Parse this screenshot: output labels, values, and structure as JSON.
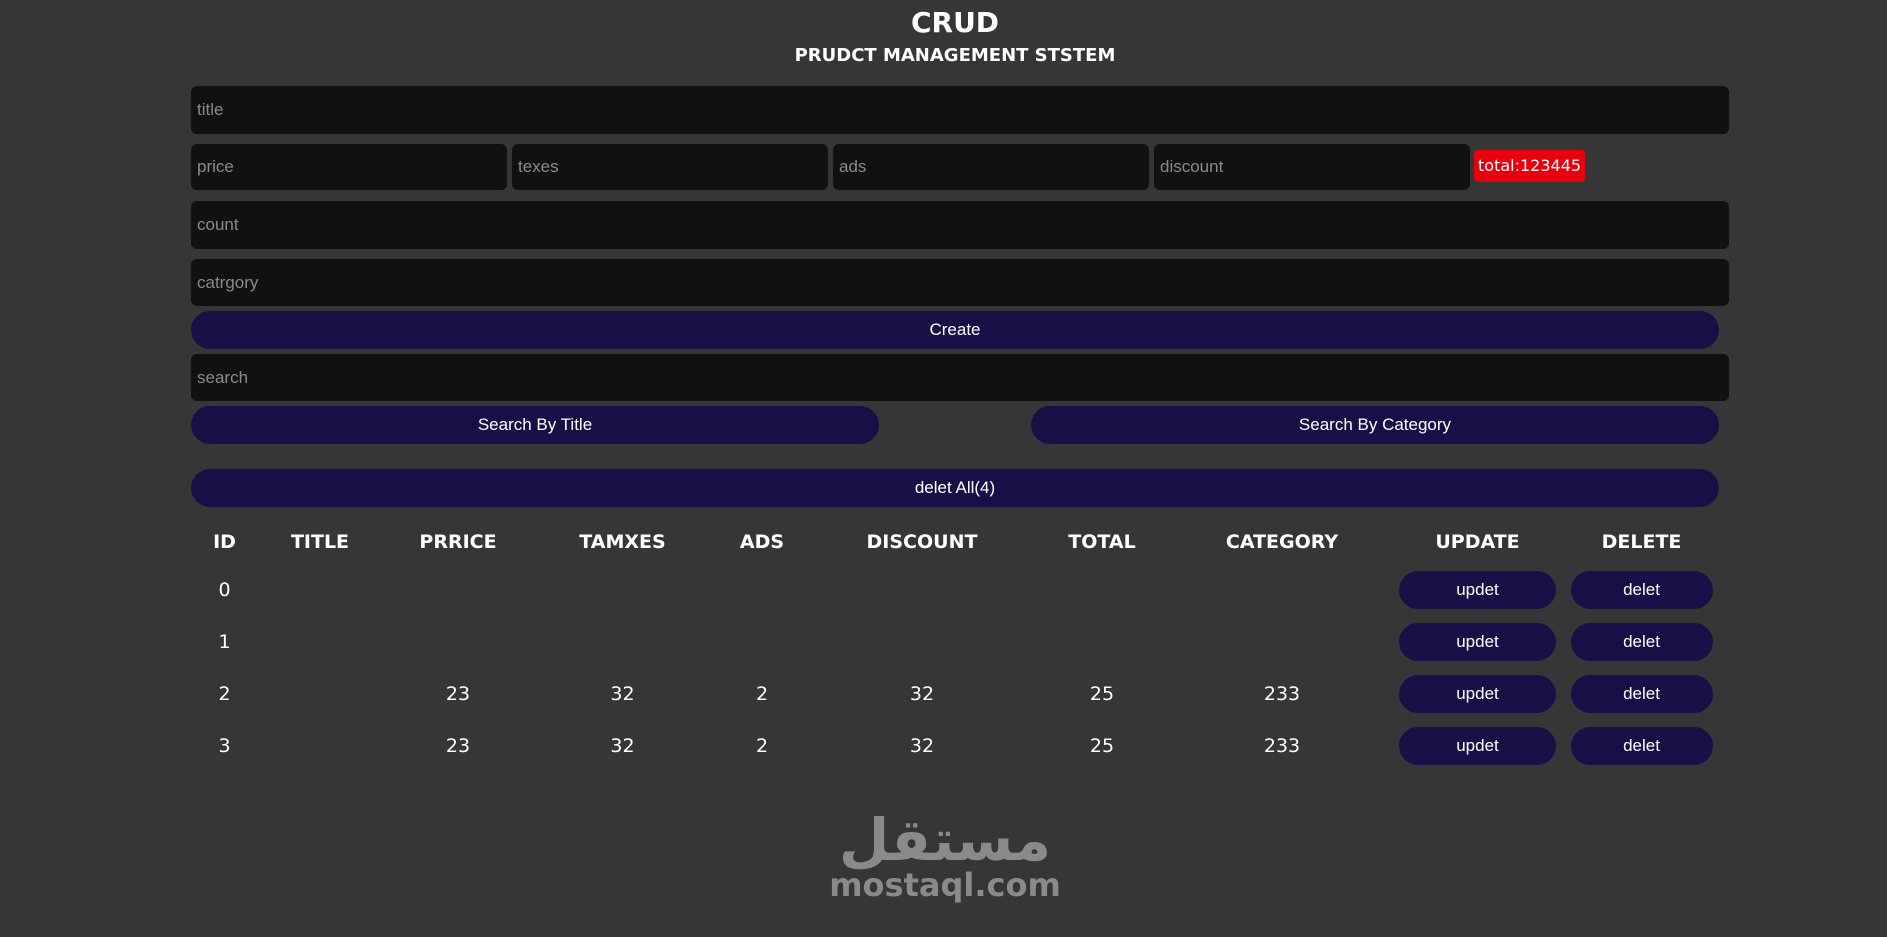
{
  "header": {
    "title": "CRUD",
    "subtitle": "PRUDCT MANAGEMENT STSTEM"
  },
  "form": {
    "title_placeholder": "title",
    "price_placeholder": "price",
    "taxes_placeholder": "texes",
    "ads_placeholder": "ads",
    "discount_placeholder": "discount",
    "total_label": "total:123445",
    "count_placeholder": "count",
    "category_placeholder": "catrgory",
    "create_label": "Create"
  },
  "search": {
    "placeholder": "search",
    "by_title_label": "Search By Title",
    "by_category_label": "Search By Category"
  },
  "delete_all_label": "delet All(4)",
  "table": {
    "headers": [
      "ID",
      "TITLE",
      "PRRICE",
      "TAMXES",
      "ADS",
      "DISCOUNT",
      "TOTAL",
      "CATEGORY",
      "UPDATE",
      "DELETE"
    ],
    "update_label": "updet",
    "delete_label": "delet",
    "rows": [
      {
        "id": "0",
        "title": "",
        "price": "",
        "taxes": "",
        "ads": "",
        "discount": "",
        "total": "",
        "category": ""
      },
      {
        "id": "1",
        "title": "",
        "price": "",
        "taxes": "",
        "ads": "",
        "discount": "",
        "total": "",
        "category": ""
      },
      {
        "id": "2",
        "title": "",
        "price": "23",
        "taxes": "32",
        "ads": "2",
        "discount": "32",
        "total": "25",
        "category": "233"
      },
      {
        "id": "3",
        "title": "",
        "price": "23",
        "taxes": "32",
        "ads": "2",
        "discount": "32",
        "total": "25",
        "category": "233"
      }
    ]
  },
  "watermark": {
    "logo_text": "مستقل",
    "domain": "mostaql.com"
  },
  "colors": {
    "background": "#363636",
    "input_bg": "#111111",
    "button_bg": "#171047",
    "total_bg": "#e8000e",
    "text": "#ffffff"
  }
}
